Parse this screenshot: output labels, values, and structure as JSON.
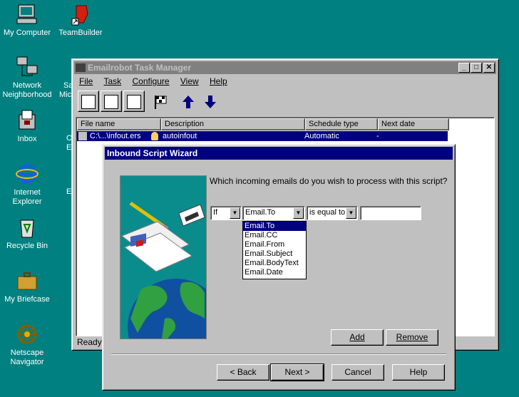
{
  "desktop": {
    "icons": [
      {
        "label": "My Computer",
        "icon": "my-computer-icon"
      },
      {
        "label": "TeamBuilder",
        "icon": "teambuilder-icon"
      },
      {
        "label": "Network Neighborhood",
        "icon": "network-icon"
      },
      {
        "label": "Inbox",
        "icon": "inbox-icon"
      },
      {
        "label": "Internet Explorer",
        "icon": "internet-explorer-icon"
      },
      {
        "label": "Recycle Bin",
        "icon": "recycle-bin-icon"
      },
      {
        "label": "My Briefcase",
        "icon": "briefcase-icon"
      },
      {
        "label": "Netscape Navigator",
        "icon": "netscape-icon"
      }
    ],
    "partial_labels": [
      "Sa",
      "Mic",
      "O",
      "E",
      "E"
    ]
  },
  "task_manager": {
    "title": "Emailrobot Task Manager",
    "menu": [
      "File",
      "Task",
      "Configure",
      "View",
      "Help"
    ],
    "columns": [
      "File name",
      "Description",
      "Schedule type",
      "Next date"
    ],
    "row": {
      "file": "C:\\...\\infout.ers",
      "description": "autoinfout",
      "schedule": "Automatic",
      "next": "-"
    },
    "status": "Ready"
  },
  "wizard": {
    "title": "Inbound Script Wizard",
    "question": "Which incoming emails do you wish to process with this script?",
    "condition": {
      "keyword": "If",
      "field": "Email.To",
      "operator": "is equal to",
      "value": ""
    },
    "field_options": [
      "Email.To",
      "Email.CC",
      "Email.From",
      "Email.Subject",
      "Email.BodyText",
      "Email.Date"
    ],
    "buttons": {
      "add": "Add",
      "remove": "Remove",
      "back": "< Back",
      "next": "Next >",
      "cancel": "Cancel",
      "help": "Help"
    }
  }
}
